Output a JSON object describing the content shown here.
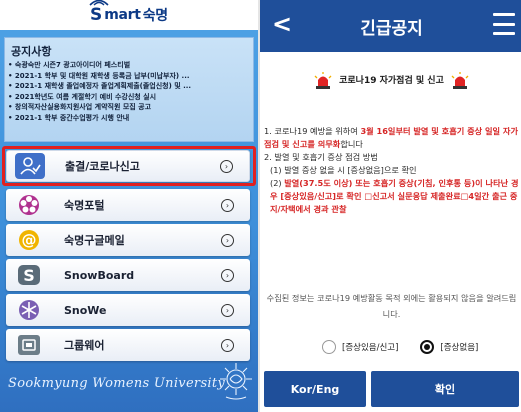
{
  "left": {
    "logo": {
      "prefix": "S",
      "word": "mart",
      "suffix": " 숙명"
    },
    "notice": {
      "title": "공지사항",
      "items": [
        "• 숙광숙만 시즌7 광고아이디어 페스티벌",
        "• 2021-1 학부 및 대학원 재학생 등록금 납부(미납부자) ...",
        "• 2021-1 재학생 졸업예정자 졸업계획제출(졸업신청) 및 ...",
        "• 2021학년도 여름 계절학기 예비 수강신청 실시",
        "• 창의적자산실용화지원사업 계약직원 모집 공고",
        "• 2021-1 학부 중간수업평가 시행 안내"
      ]
    },
    "menu": [
      {
        "label": "출결/코로나신고",
        "icon": "person-checkin-icon"
      },
      {
        "label": "숙명포털",
        "icon": "portal-flower-icon"
      },
      {
        "label": "숙명구글메일",
        "icon": "at-sign-icon"
      },
      {
        "label": "SnowBoard",
        "icon": "snowboard-s-icon"
      },
      {
        "label": "SnoWe",
        "icon": "snowflake-icon"
      },
      {
        "label": "그룹웨어",
        "icon": "groupware-icon"
      }
    ],
    "chevron": "›",
    "slogan": "Sookmyung Womens University",
    "colors": {
      "brand": "#0d3a86",
      "panel_top": "#4fa3e6",
      "highlight": "#e02020"
    }
  },
  "right": {
    "title": "긴급공지",
    "back": "<",
    "subject": "코로나19 자가점검 및 신고",
    "body": {
      "p1_a": "1. 코로나19 예방을 위하여 ",
      "p1_hl": "3월 16일부터 발열 및 호흡기 증상 일일 자가 점검 및 신고를 의무화",
      "p1_b": "합니다",
      "p2": "2. 발열 및 호흡기 증상 점검 방법",
      "p3": "(1) 발열 증상 없을 시 [증상없음]으로 확인",
      "p4_a": "(2) ",
      "p4_hl": "발열(37.5도 이상) 또는 호흡기 증상(기침, 인후통 등)이 나타난 경우 [증상있음/신고]로 확인 □신고서 실문응답 제출완료□4일간 출근 중지/자택에서 경과 관찰"
    },
    "footer": "수집된 정보는 코로나19 예방활동 목적 외에는 활용되지 않음을 알려드립니다.",
    "radio_report": "[증상있음/신고]",
    "radio_none": "[증상없음]",
    "btn_lang": "Kor/Eng",
    "btn_ok": "확인",
    "colors": {
      "header": "#1f4f9a",
      "alert_red": "#d62626"
    }
  }
}
